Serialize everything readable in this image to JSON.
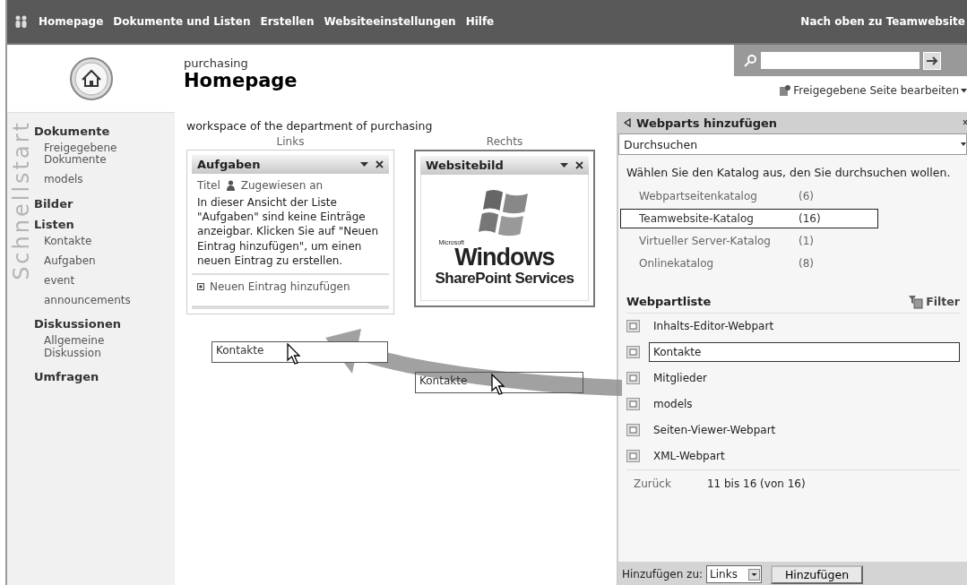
{
  "top_nav": {
    "items": [
      "Homepage",
      "Dokumente und Listen",
      "Erstellen",
      "Websiteeinstellungen",
      "Hilfe"
    ],
    "right_link": "Nach oben zu Teamwebsite"
  },
  "header": {
    "site": "purchasing",
    "title": "Homepage",
    "edit_page": "Freigegebene Seite bearbeiten"
  },
  "quicklaunch": {
    "label": "Schnellstart",
    "sections": [
      {
        "title": "Dokumente",
        "children": [
          {
            "label": "Freigegebene Dokumente"
          },
          {
            "label": "models"
          }
        ]
      },
      {
        "title": "Bilder"
      },
      {
        "title": "Listen",
        "children": [
          {
            "label": "Kontakte"
          },
          {
            "label": "Aufgaben"
          },
          {
            "label": "event"
          },
          {
            "label": "announcements"
          }
        ]
      },
      {
        "title": "Diskussionen",
        "children": [
          {
            "label": "Allgemeine Diskussion"
          }
        ]
      },
      {
        "title": "Umfragen"
      }
    ]
  },
  "description": "workspace of the department of purchasing",
  "zones": [
    {
      "label": "Links",
      "webparts": [
        {
          "kind": "list",
          "title": "Aufgaben",
          "columns": [
            "Titel",
            "Zugewiesen an"
          ],
          "message": "In dieser Ansicht der Liste \"Aufgaben\" sind keine Einträge anzeigbar. Klicken Sie auf \"Neuen Eintrag hinzufügen\", um einen neuen Eintrag zu erstellen.",
          "add_link": "Neuen Eintrag hinzufügen"
        }
      ]
    },
    {
      "label": "Rechts",
      "webparts": [
        {
          "kind": "image",
          "title": "Websitebild",
          "logo_lines": [
            "Microsoft",
            "Windows",
            "SharePoint Services"
          ]
        }
      ]
    }
  ],
  "drag_ghosts": [
    "Kontakte",
    "Kontakte"
  ],
  "tool_pane": {
    "title": "Webparts hinzufügen",
    "mode": "Durchsuchen",
    "instruction": "Wählen Sie den Katalog aus, den Sie durchsuchen wollen.",
    "catalogs": [
      {
        "name": "Webpartseitenkatalog",
        "count": "(6)",
        "selected": false
      },
      {
        "name": "Teamwebsite-Katalog",
        "count": "(16)",
        "selected": true
      },
      {
        "name": "Virtueller Server-Katalog",
        "count": "(1)",
        "selected": false
      },
      {
        "name": "Onlinekatalog",
        "count": "(8)",
        "selected": false
      }
    ],
    "list_title": "Webpartliste",
    "filter": "Filter",
    "webparts": [
      {
        "name": "Inhalts-Editor-Webpart",
        "selected": false
      },
      {
        "name": "Kontakte",
        "selected": true
      },
      {
        "name": "Mitglieder",
        "selected": false
      },
      {
        "name": "models",
        "selected": false
      },
      {
        "name": "Seiten-Viewer-Webpart",
        "selected": false
      },
      {
        "name": "XML-Webpart",
        "selected": false
      }
    ],
    "back": "Zurück",
    "range": "11 bis 16 (von 16)",
    "add_to_label": "Hinzufügen zu:",
    "add_to_zone": "Links",
    "add_button": "Hinzufügen"
  }
}
